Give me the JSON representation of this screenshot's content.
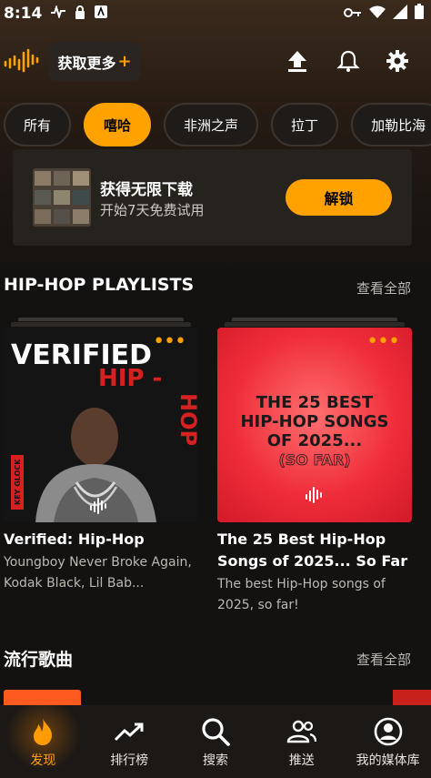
{
  "status_bar": {
    "time": "8:14"
  },
  "header": {
    "get_more_label": "获取更多",
    "get_more_plus": "+"
  },
  "chips": [
    "所有",
    "嘻哈",
    "非洲之声",
    "拉丁",
    "加勒比海"
  ],
  "active_chip": "嘻哈",
  "promo": {
    "title": "获得无限下载",
    "subtitle": "开始7天免费试用",
    "button": "解锁"
  },
  "section_playlists": {
    "title": "HIP-HOP PLAYLISTS",
    "see_all": "查看全部",
    "cards": [
      {
        "title": "Verified: Hip-Hop",
        "subtitle": "Youngboy Never Broke Again, Kodak Black, Lil Bab...",
        "art_text_1": "VERIFIED",
        "art_text_2": "HIP-HOP",
        "art_side_text": "KEY GLOCK"
      },
      {
        "title": "The 25 Best Hip-Hop Songs of 2025... So Far",
        "subtitle": "The best Hip-Hop songs of 2025, so far!",
        "art_text_1": "THE 25 BEST",
        "art_text_2": "HIP-HOP SONGS",
        "art_text_3": "OF 2025...",
        "art_text_4": "(SO FAR)"
      }
    ]
  },
  "section_popular": {
    "title": "流行歌曲",
    "see_all": "查看全部"
  },
  "bottom_nav": [
    {
      "label": "发现",
      "icon": "flame-icon"
    },
    {
      "label": "排行榜",
      "icon": "trending-icon"
    },
    {
      "label": "搜索",
      "icon": "search-icon"
    },
    {
      "label": "推送",
      "icon": "people-icon"
    },
    {
      "label": "我的媒体库",
      "icon": "account-icon"
    }
  ],
  "colors": {
    "accent": "#ffa200",
    "background": "#141210"
  }
}
